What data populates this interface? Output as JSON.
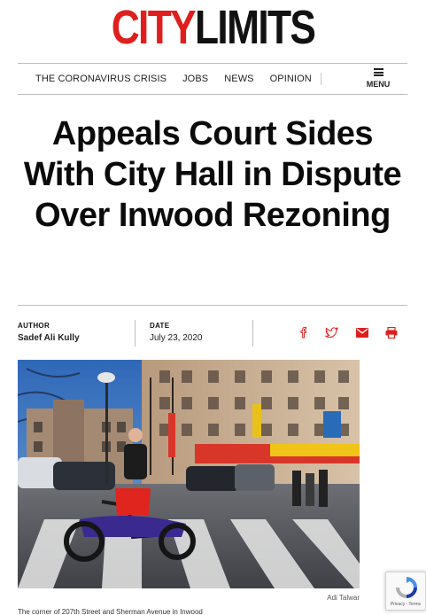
{
  "logo": {
    "city": "CITY",
    "limits": "LIMITS"
  },
  "nav": {
    "items": [
      "THE CORONAVIRUS CRISIS",
      "JOBS",
      "NEWS",
      "OPINION"
    ],
    "menu_label": "MENU"
  },
  "article": {
    "headline": "Appeals Court Sides With City Hall in Dispute Over Inwood Rezoning",
    "author_label": "AUTHOR",
    "author": "Sadef Ali Kully",
    "date_label": "DATE",
    "date": "July 23, 2020",
    "photo_credit": "Adi Talwar",
    "caption": "The corner of 207th Street and Sherman Avenue in Inwood"
  },
  "share_icons": [
    "facebook-icon",
    "twitter-icon",
    "email-icon",
    "print-icon"
  ],
  "recaptcha": {
    "text": "Privacy - Terms"
  },
  "colors": {
    "brand_red": "#e01e1e",
    "text_dark": "#111111"
  }
}
